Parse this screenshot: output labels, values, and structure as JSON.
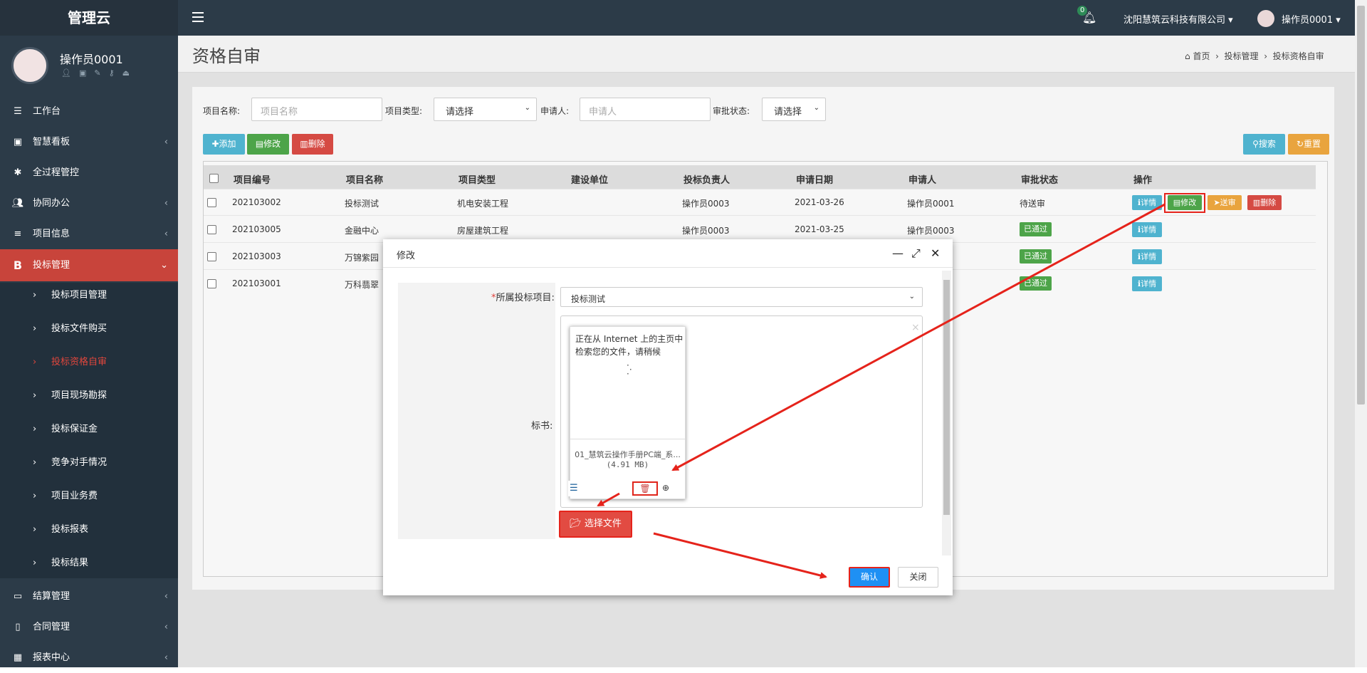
{
  "app": {
    "logo": "管理云",
    "company": "沈阳慧筑云科技有限公司",
    "top_user": "操作员0001",
    "notif_count": "0"
  },
  "user": {
    "name": "操作员0001"
  },
  "nav": [
    {
      "label": "工作台",
      "icon": "workbench-icon"
    },
    {
      "label": "智慧看板",
      "icon": "dashboard-icon"
    },
    {
      "label": "全过程管控",
      "icon": "asterisk-icon"
    },
    {
      "label": "协同办公",
      "icon": "users-icon"
    },
    {
      "label": "项目信息",
      "icon": "list-icon"
    },
    {
      "label": "投标管理",
      "icon": "bold-b-icon"
    },
    {
      "label": "结算管理",
      "icon": "monitor-icon"
    },
    {
      "label": "合同管理",
      "icon": "file-icon"
    },
    {
      "label": "报表中心",
      "icon": "table-icon"
    }
  ],
  "submenu": [
    "投标项目管理",
    "投标文件购买",
    "投标资格自审",
    "项目现场勘探",
    "投标保证金",
    "竞争对手情况",
    "项目业务费",
    "投标报表",
    "投标结果"
  ],
  "page": {
    "title": "资格自审",
    "breadcrumb": [
      "首页",
      "投标管理",
      "投标资格自审"
    ]
  },
  "filters": {
    "project_name_label": "项目名称:",
    "project_name_placeholder": "项目名称",
    "project_type_label": "项目类型:",
    "project_type_value": "请选择",
    "applicant_label": "申请人:",
    "applicant_placeholder": "申请人",
    "status_label": "审批状态:",
    "status_value": "请选择"
  },
  "toolbar": {
    "add": "添加",
    "edit": "修改",
    "delete": "删除",
    "search": "搜索",
    "reset": "重置"
  },
  "table": {
    "headers": [
      "项目编号",
      "项目名称",
      "项目类型",
      "建设单位",
      "投标负责人",
      "申请日期",
      "申请人",
      "审批状态",
      "操作"
    ],
    "rows": [
      {
        "id": "202103002",
        "name": "投标测试",
        "type": "机电安装工程",
        "owner": "操作员0003",
        "date": "2021-03-26",
        "applicant": "操作员0001",
        "status": "待送审"
      },
      {
        "id": "202103005",
        "name": "金融中心",
        "type": "房屋建筑工程",
        "owner": "操作员0003",
        "date": "2021-03-25",
        "applicant": "操作员0003",
        "status": "已通过"
      },
      {
        "id": "202103003",
        "name": "万锦紫园",
        "status": "已通过"
      },
      {
        "id": "202103001",
        "name": "万科翡翠",
        "status": "已通过"
      }
    ],
    "row_actions": {
      "detail": "详情",
      "edit": "修改",
      "submit": "送审",
      "delete": "删除"
    }
  },
  "dialog": {
    "title": "修改",
    "field1_label": "所属投标项目:",
    "field1_required": "*",
    "field1_value": "投标测试",
    "field2_label": "标书:",
    "preview_text": "正在从 Internet 上的主页中检索您的文件，请稍候",
    "file_name": "01_慧筑云操作手册PC端_系...",
    "file_size": "(4.91 MB)",
    "choose_file": "选择文件",
    "confirm": "确认",
    "close": "关闭"
  },
  "colors": {
    "sidebar": "#2c3b48",
    "active": "#c8443b",
    "highlight": "#e5231b"
  }
}
